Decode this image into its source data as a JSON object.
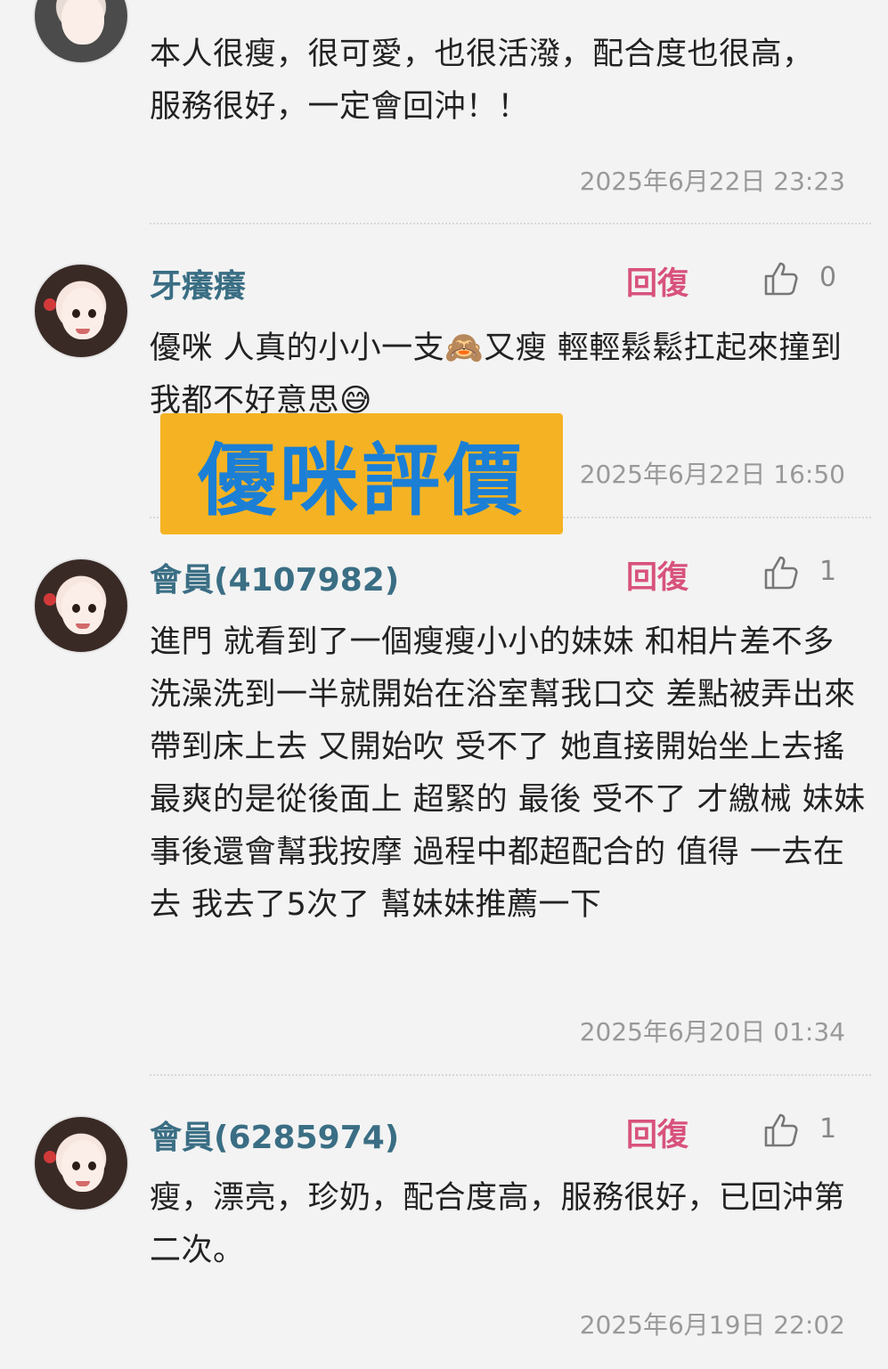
{
  "comments": [
    {
      "username": "",
      "text": "本人很瘦，很可愛，也很活潑，配合度也很高，服務很好，一定會回沖！！",
      "timestamp": "2025年6月22日 23:23"
    },
    {
      "username": "牙癢癢",
      "reply_label": "回復",
      "likes": "0",
      "text": "優咪 人真的小小一支🙈又瘦 輕輕鬆鬆扛起來撞到我都不好意思😅",
      "timestamp": "2025年6月22日 16:50"
    },
    {
      "username": "會員(4107982)",
      "reply_label": "回復",
      "likes": "1",
      "text": "進門 就看到了一個瘦瘦小小的妹妹 和相片差不多 洗澡洗到一半就開始在浴室幫我口交 差點被弄出來 帶到床上去 又開始吹 受不了 她直接開始坐上去搖 最爽的是從後面上 超緊的 最後 受不了 才繳械 妹妹事後還會幫我按摩 過程中都超配合的 值得 一去在去 我去了5次了 幫妹妹推薦一下",
      "timestamp": "2025年6月20日 01:34"
    },
    {
      "username": "會員(6285974)",
      "reply_label": "回復",
      "likes": "1",
      "text": "瘦，漂亮，珍奶，配合度高，服務很好，已回沖第二次。",
      "timestamp": "2025年6月19日 22:02"
    }
  ],
  "overlay_badge": "優咪評價",
  "colors": {
    "username": "#3a6e84",
    "reply": "#d8527c",
    "badge_bg": "#f5b323",
    "badge_text": "#1b7fd6"
  }
}
